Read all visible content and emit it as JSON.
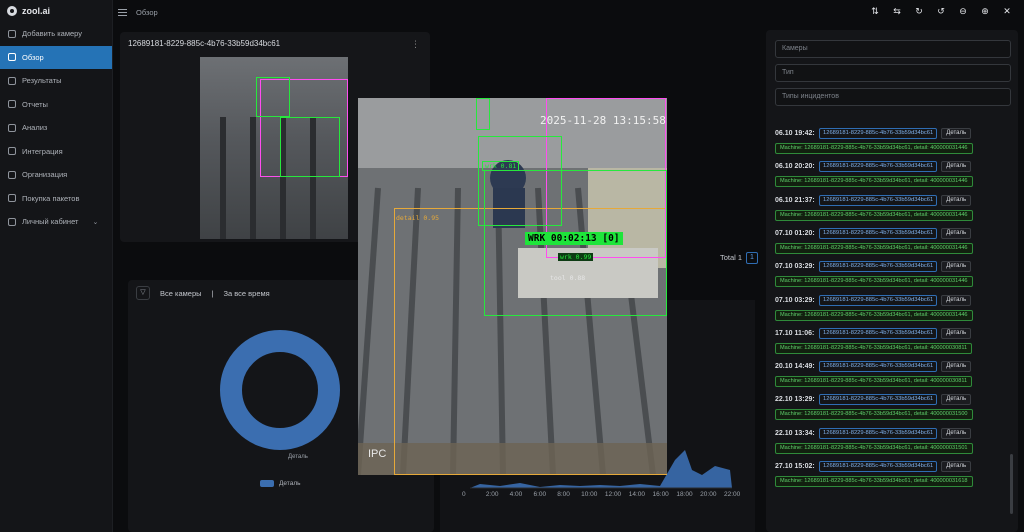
{
  "app": {
    "brand": "zool.ai"
  },
  "sidebar": {
    "items": [
      {
        "label": "Добавить камеру",
        "active": false
      },
      {
        "label": "Обзор",
        "active": true
      },
      {
        "label": "Результаты",
        "active": false
      },
      {
        "label": "Отчеты",
        "active": false
      },
      {
        "label": "Анализ",
        "active": false
      },
      {
        "label": "Интеграция",
        "active": false
      },
      {
        "label": "Организация",
        "active": false
      },
      {
        "label": "Покупка пакетов",
        "active": false
      },
      {
        "label": "Личный кабинет",
        "active": false,
        "expandable": true
      }
    ]
  },
  "header": {
    "breadcrumb": "Обзор"
  },
  "camera_card": {
    "title": "12689181-8229-885c-4b76-33b59d34bc61"
  },
  "stats": {
    "filter_cameras": "Все камеры",
    "separator": "|",
    "filter_period": "За все время",
    "donut_label": "Деталь",
    "legend": "Деталь",
    "accent": "#3b6eb0"
  },
  "pagination": {
    "total": "Total 1",
    "page": "1"
  },
  "chart_axis": {
    "x_ticks": [
      "0",
      "2:00",
      "4:00",
      "6:00",
      "8:00",
      "10:00",
      "12:00",
      "14:00",
      "16:00",
      "18:00",
      "20:00",
      "22:00"
    ]
  },
  "filters": {
    "cameras_placeholder": "Камеры",
    "types_placeholder": "Тип",
    "incident_types_placeholder": "Типы инцидентов"
  },
  "events": [
    {
      "time": "06.10 19:42:",
      "camera": "12689181-8229-885c-4b76-33b59d34bc61",
      "action": "Деталь",
      "tag": "Machine: 12689181-8229-885c-4b76-33b59d34bc61, detail: 400000031446"
    },
    {
      "time": "06.10 20:20:",
      "camera": "12689181-8229-885c-4b76-33b59d34bc61",
      "action": "Деталь",
      "tag": "Machine: 12689181-8229-885c-4b76-33b59d34bc61, detail: 400000031446"
    },
    {
      "time": "06.10 21:37:",
      "camera": "12689181-8229-885c-4b76-33b59d34bc61",
      "action": "Деталь",
      "tag": "Machine: 12689181-8229-885c-4b76-33b59d34bc61, detail: 400000031446"
    },
    {
      "time": "07.10 01:20:",
      "camera": "12689181-8229-885c-4b76-33b59d34bc61",
      "action": "Деталь",
      "tag": "Machine: 12689181-8229-885c-4b76-33b59d34bc61, detail: 400000031446"
    },
    {
      "time": "07.10 03:29:",
      "camera": "12689181-8229-885c-4b76-33b59d34bc61",
      "action": "Деталь",
      "tag": "Machine: 12689181-8229-885c-4b76-33b59d34bc61, detail: 400000031446"
    },
    {
      "time": "07.10 03:29:",
      "camera": "12689181-8229-885c-4b76-33b59d34bc61",
      "action": "Деталь",
      "tag": "Machine: 12689181-8229-885c-4b76-33b59d34bc61, detail: 400000031446"
    },
    {
      "time": "17.10 11:06:",
      "camera": "12689181-8229-885c-4b76-33b59d34bc61",
      "action": "Деталь",
      "tag": "Machine: 12689181-8229-885c-4b76-33b59d34bc61, detail: 400000030811"
    },
    {
      "time": "20.10 14:49:",
      "camera": "12689181-8229-885c-4b76-33b59d34bc61",
      "action": "Деталь",
      "tag": "Machine: 12689181-8229-885c-4b76-33b59d34bc61, detail: 400000030811"
    },
    {
      "time": "22.10 13:29:",
      "camera": "12689181-8229-885c-4b76-33b59d34bc61",
      "action": "Деталь",
      "tag": "Machine: 12689181-8229-885c-4b76-33b59d34bc61, detail: 400000031500"
    },
    {
      "time": "22.10 13:34:",
      "camera": "12689181-8229-885c-4b76-33b59d34bc61",
      "action": "Деталь",
      "tag": "Machine: 12689181-8229-885c-4b76-33b59d34bc61, detail: 400000031501"
    },
    {
      "time": "27.10 15:02:",
      "camera": "12689181-8229-885c-4b76-33b59d34bc61",
      "action": "Деталь",
      "tag": "Machine: 12689181-8229-885c-4b76-33b59d34bc61, detail: 400000031618"
    }
  ],
  "video": {
    "timestamp": "2025-11-28 13:15:58",
    "channel": "IPC",
    "work_label": "WRK 00:02:13 [0]",
    "det_worker": "wrk 0.81",
    "det_work": "wrk 0.99",
    "det_detail": "detail 0.95",
    "det_tool": "tool 0.88"
  }
}
